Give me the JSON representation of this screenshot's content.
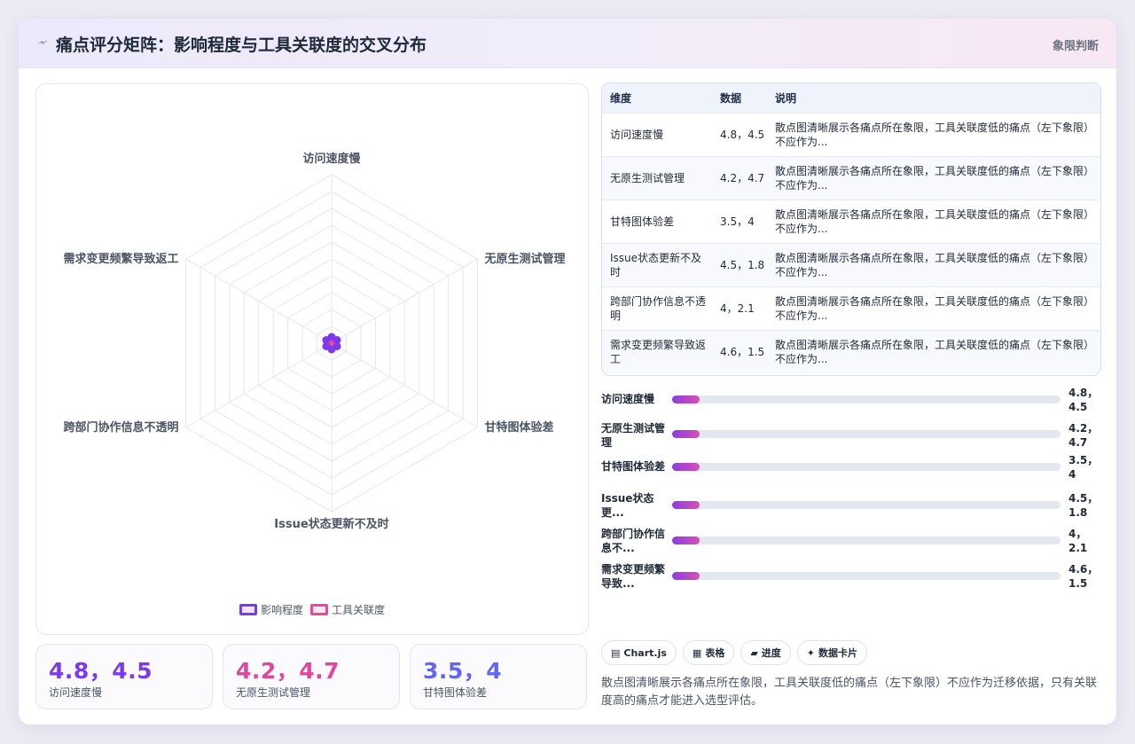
{
  "header": {
    "title": "痛点评分矩阵：影响程度与工具关联度的交叉分布",
    "badge": "象限判断"
  },
  "chart_data": {
    "type": "radar",
    "axes": [
      "访问速度慢",
      "无原生测试管理",
      "甘特图体验差",
      "Issue状态更新不及时",
      "跨部门协作信息不透明",
      "需求变更频繁导致返工"
    ],
    "series": [
      {
        "name": "影响程度",
        "color": "#7c3aed",
        "values": [
          0,
          0,
          0,
          0,
          0,
          0
        ]
      },
      {
        "name": "工具关联度",
        "color": "#ec4899",
        "values": [
          0,
          0,
          0,
          0,
          0,
          0
        ]
      }
    ],
    "legend_position": "bottom",
    "grid": true
  },
  "legend": [
    {
      "label": "影响程度",
      "color": "#7c3aed"
    },
    {
      "label": "工具关联度",
      "color": "#ec4899"
    }
  ],
  "kpis": [
    {
      "value": "4.8，4.5",
      "label": "访问速度慢",
      "color": "#7c3aed"
    },
    {
      "value": "4.2，4.7",
      "label": "无原生测试管理",
      "color": "#e0479b"
    },
    {
      "value": "3.5，4",
      "label": "甘特图体验差",
      "color": "#6366f1"
    }
  ],
  "table": {
    "headers": [
      "维度",
      "数据",
      "说明"
    ],
    "rows": [
      {
        "dim": "访问速度慢",
        "num": "4.8，4.5",
        "desc": "散点图清晰展示各痛点所在象限，工具关联度低的痛点（左下象限）不应作为..."
      },
      {
        "dim": "无原生测试管理",
        "num": "4.2，4.7",
        "desc": "散点图清晰展示各痛点所在象限，工具关联度低的痛点（左下象限）不应作为..."
      },
      {
        "dim": "甘特图体验差",
        "num": "3.5，4",
        "desc": "散点图清晰展示各痛点所在象限，工具关联度低的痛点（左下象限）不应作为..."
      },
      {
        "dim": "Issue状态更新不及时",
        "num": "4.5，1.8",
        "desc": "散点图清晰展示各痛点所在象限，工具关联度低的痛点（左下象限）不应作为..."
      },
      {
        "dim": "跨部门协作信息不透明",
        "num": "4，2.1",
        "desc": "散点图清晰展示各痛点所在象限，工具关联度低的痛点（左下象限）不应作为..."
      },
      {
        "dim": "需求变更频繁导致返工",
        "num": "4.6，1.5",
        "desc": "散点图清晰展示各痛点所在象限，工具关联度低的痛点（左下象限）不应作为..."
      }
    ]
  },
  "bars": [
    {
      "label": "访问速度慢",
      "value": "4.8，4.5",
      "fill_fraction": 0.07
    },
    {
      "label": "无原生测试管理",
      "value": "4.2，4.7",
      "fill_fraction": 0.07
    },
    {
      "label": "甘特图体验差",
      "value": "3.5，4",
      "fill_fraction": 0.07
    },
    {
      "label": "Issue状态更...",
      "value": "4.5，1.8",
      "fill_fraction": 0.07
    },
    {
      "label": "跨部门协作信息不...",
      "value": "4，2.1",
      "fill_fraction": 0.07
    },
    {
      "label": "需求变更频繁导致...",
      "value": "4.6，1.5",
      "fill_fraction": 0.07
    }
  ],
  "tags": [
    {
      "icon": "▤",
      "label": "Chart.js",
      "icon_name": "chart-icon"
    },
    {
      "icon": "▦",
      "label": "表格",
      "icon_name": "table-icon"
    },
    {
      "icon": "▰",
      "label": "进度",
      "icon_name": "progress-icon"
    },
    {
      "icon": "✦",
      "label": "数据卡片",
      "icon_name": "sparkle-icon"
    }
  ],
  "note": "散点图清晰展示各痛点所在象限，工具关联度低的痛点（左下象限）不应作为迁移依据，只有关联度高的痛点才能进入选型评估。"
}
